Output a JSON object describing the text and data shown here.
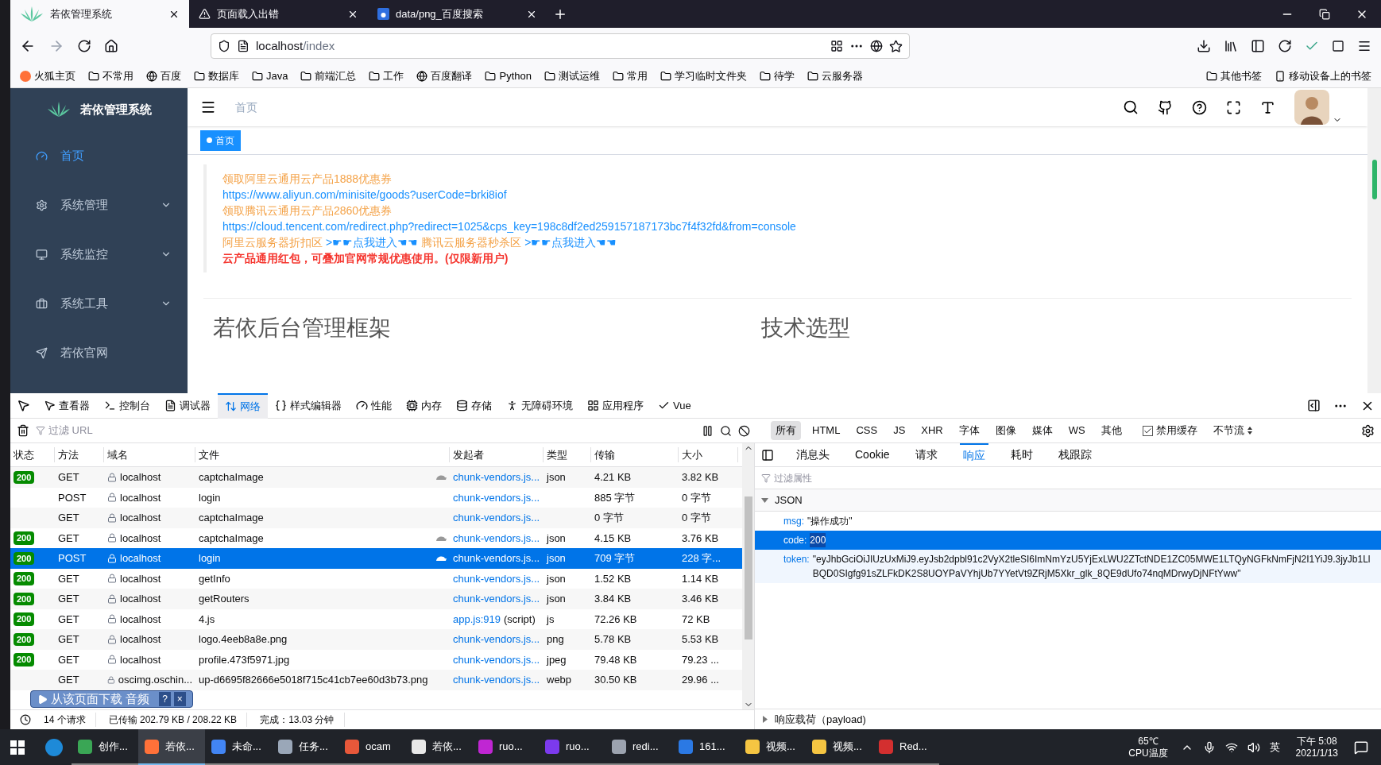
{
  "browser": {
    "tabs": [
      {
        "title": "若依管理系统",
        "selected": true
      },
      {
        "title": "页面载入出错",
        "selected": false
      },
      {
        "title": "data/png_百度搜索",
        "selected": false
      }
    ],
    "url_host": "localhost",
    "url_path": "/index",
    "bookmarks": [
      {
        "label": "火狐主页",
        "kind": "site"
      },
      {
        "label": "不常用",
        "kind": "folder"
      },
      {
        "label": "百度",
        "kind": "globe"
      },
      {
        "label": "数据库",
        "kind": "folder"
      },
      {
        "label": "Java",
        "kind": "folder"
      },
      {
        "label": "前端汇总",
        "kind": "folder"
      },
      {
        "label": "工作",
        "kind": "folder"
      },
      {
        "label": "百度翻译",
        "kind": "globe"
      },
      {
        "label": "Python",
        "kind": "folder"
      },
      {
        "label": "测试运维",
        "kind": "folder"
      },
      {
        "label": "常用",
        "kind": "folder"
      },
      {
        "label": "学习临时文件夹",
        "kind": "folder"
      },
      {
        "label": "待学",
        "kind": "folder"
      },
      {
        "label": "云服务器",
        "kind": "folder"
      }
    ],
    "bookmarks_right": [
      {
        "label": "其他书签",
        "kind": "folder"
      },
      {
        "label": "移动设备上的书签",
        "kind": "mobile"
      }
    ]
  },
  "app": {
    "logo_title": "若依管理系统",
    "sidebar": [
      {
        "label": "首页",
        "selected": true,
        "expandable": false
      },
      {
        "label": "系统管理",
        "selected": false,
        "expandable": true
      },
      {
        "label": "系统监控",
        "selected": false,
        "expandable": true
      },
      {
        "label": "系统工具",
        "selected": false,
        "expandable": true
      },
      {
        "label": "若依官网",
        "selected": false,
        "expandable": false
      }
    ],
    "breadcrumb": "首页",
    "tags": [
      {
        "label": "首页",
        "selected": true
      }
    ],
    "ads": [
      [
        {
          "text": "领取阿里云通用云产品1888优惠券",
          "kind": "promo"
        }
      ],
      [
        {
          "text": "https://www.aliyun.com/minisite/goods?userCode=brki8iof",
          "kind": "link"
        }
      ],
      [
        {
          "text": "领取腾讯云通用云产品2860优惠券",
          "kind": "promo"
        }
      ],
      [
        {
          "text": "https://cloud.tencent.com/redirect.php?redirect=1025&cps_key=198c8df2ed259157187173bc7f4f32fd&from=console",
          "kind": "link"
        }
      ],
      [
        {
          "text": "阿里云服务器折扣区",
          "kind": "promo"
        },
        {
          "text": ">☛☛点我进入☚☚",
          "kind": "link"
        },
        {
          "text": "腾讯云服务器秒杀区",
          "kind": "promo"
        },
        {
          "text": ">☛☛点我进入☚☚",
          "kind": "link"
        }
      ],
      [
        {
          "text": "云产品通用红包，可叠加官网常规优惠使用。(仅限新用户)",
          "kind": "notice"
        }
      ]
    ],
    "headings": [
      "若依后台管理框架",
      "技术选型"
    ]
  },
  "devtools": {
    "tools": [
      {
        "label": "查看器",
        "selected": false
      },
      {
        "label": "控制台",
        "selected": false
      },
      {
        "label": "调试器",
        "selected": false
      },
      {
        "label": "网络",
        "selected": true
      },
      {
        "label": "样式编辑器",
        "selected": false
      },
      {
        "label": "性能",
        "selected": false
      },
      {
        "label": "内存",
        "selected": false
      },
      {
        "label": "存储",
        "selected": false
      },
      {
        "label": "无障碍环境",
        "selected": false
      },
      {
        "label": "应用程序",
        "selected": false
      },
      {
        "label": "Vue",
        "selected": false
      }
    ],
    "filter_placeholder": "过滤 URL",
    "type_filters": [
      {
        "label": "所有",
        "selected": true
      },
      {
        "label": "HTML",
        "selected": false
      },
      {
        "label": "CSS",
        "selected": false
      },
      {
        "label": "JS",
        "selected": false
      },
      {
        "label": "XHR",
        "selected": false
      },
      {
        "label": "字体",
        "selected": false
      },
      {
        "label": "图像",
        "selected": false
      },
      {
        "label": "媒体",
        "selected": false
      },
      {
        "label": "WS",
        "selected": false
      },
      {
        "label": "其他",
        "selected": false
      }
    ],
    "disable_cache": {
      "label": "禁用缓存",
      "checked": true
    },
    "throttle": "不节流",
    "columns": [
      "状态",
      "方法",
      "域名",
      "文件",
      "发起者",
      "类型",
      "传输",
      "大小"
    ],
    "rows": [
      {
        "status": "200",
        "method": "GET",
        "domain": "localhost",
        "file": "captchaImage",
        "flagged": true,
        "initiator": "chunk-vendors.js...",
        "type": "json",
        "transfer": "4.21 KB",
        "size": "3.82 KB",
        "selected": false
      },
      {
        "method": "POST",
        "domain": "localhost",
        "file": "login",
        "flagged": false,
        "initiator": "chunk-vendors.js...",
        "transfer": "885 字节",
        "size": "0 字节",
        "selected": false
      },
      {
        "method": "GET",
        "domain": "localhost",
        "file": "captchaImage",
        "flagged": false,
        "initiator": "chunk-vendors.js...",
        "transfer": "0 字节",
        "size": "0 字节",
        "selected": false
      },
      {
        "status": "200",
        "method": "GET",
        "domain": "localhost",
        "file": "captchaImage",
        "flagged": true,
        "initiator": "chunk-vendors.js...",
        "type": "json",
        "transfer": "4.15 KB",
        "size": "3.76 KB",
        "selected": false
      },
      {
        "status": "200",
        "method": "POST",
        "domain": "localhost",
        "file": "login",
        "flagged": true,
        "initiator": "chunk-vendors.js...",
        "type": "json",
        "transfer": "709 字节",
        "size": "228 字...",
        "selected": true
      },
      {
        "status": "200",
        "method": "GET",
        "domain": "localhost",
        "file": "getInfo",
        "flagged": false,
        "initiator": "chunk-vendors.js...",
        "type": "json",
        "transfer": "1.52 KB",
        "size": "1.14 KB",
        "selected": false
      },
      {
        "status": "200",
        "method": "GET",
        "domain": "localhost",
        "file": "getRouters",
        "flagged": false,
        "initiator": "chunk-vendors.js...",
        "type": "json",
        "transfer": "3.84 KB",
        "size": "3.46 KB",
        "selected": false
      },
      {
        "status": "200",
        "method": "GET",
        "domain": "localhost",
        "file": "4.js",
        "flagged": false,
        "initiator": "app.js:919",
        "initiator_note": "(script)",
        "type": "js",
        "transfer": "72.26 KB",
        "size": "72 KB",
        "selected": false
      },
      {
        "status": "200",
        "method": "GET",
        "domain": "localhost",
        "file": "logo.4eeb8a8e.png",
        "flagged": false,
        "initiator": "chunk-vendors.js...",
        "type": "png",
        "transfer": "5.78 KB",
        "size": "5.53 KB",
        "selected": false
      },
      {
        "status": "200",
        "method": "GET",
        "domain": "localhost",
        "file": "profile.473f5971.jpg",
        "flagged": false,
        "initiator": "chunk-vendors.js...",
        "type": "jpeg",
        "transfer": "79.48 KB",
        "size": "79.23 ...",
        "selected": false
      },
      {
        "method": "GET",
        "domain": "oscimg.oschin...",
        "file": "up-d6695f82666e5018f715c41cb7ee60d3b73.png",
        "flagged": false,
        "initiator": "chunk-vendors.js...",
        "type": "webp",
        "transfer": "30.50 KB",
        "size": "29.96 ...",
        "selected": false
      }
    ],
    "status_bar": [
      "14 个请求",
      "已传输 202.79 KB / 208.22 KB",
      "完成：13.03 分钟"
    ],
    "detail_tabs": [
      {
        "label": "消息头",
        "selected": false
      },
      {
        "label": "Cookie",
        "selected": false
      },
      {
        "label": "请求",
        "selected": false
      },
      {
        "label": "响应",
        "selected": true
      },
      {
        "label": "耗时",
        "selected": false
      },
      {
        "label": "栈跟踪",
        "selected": false
      }
    ],
    "props_placeholder": "过滤属性",
    "json": {
      "label": "JSON",
      "expanded": true,
      "entries": [
        {
          "key": "msg:",
          "value": "\"操作成功\"",
          "selected": false
        },
        {
          "key": "code:",
          "value": "200",
          "selected": true
        },
        {
          "key": "token:",
          "value": "\"eyJhbGciOiJIUzUxMiJ9.eyJsb2dpbl91c2VyX2tleSI6ImNmYzU5YjExLWU2ZTctNDE1ZC05MWE1LTQyNGFkNmFjN2I1YiJ9.3jyJb1LlBQD0SIgfg91sZLFkDK2S8UOYPaVYhjUb7YYetVt9ZRjM5Xkr_glk_8QE9dUfo74nqMDrwyDjNFtYww\"",
          "selected": false
        }
      ]
    },
    "payload": {
      "label": "响应载荷（payload)",
      "expanded": false
    }
  },
  "overlay": {
    "label": "从该页面下载 音频",
    "help": "?",
    "close": "×"
  },
  "taskbar": {
    "apps": [
      {
        "label": "创作...",
        "color": "#3aa655",
        "selected": false
      },
      {
        "label": "若依...",
        "color": "#ff7139",
        "selected": true
      },
      {
        "label": "未命...",
        "color": "#4285f4",
        "selected": false
      },
      {
        "label": "任务...",
        "color": "#9aa7b8",
        "selected": false
      },
      {
        "label": "ocam",
        "color": "#e8583a",
        "selected": false
      },
      {
        "label": "若依...",
        "color": "#e8e8e8",
        "selected": false
      },
      {
        "label": "ruo...",
        "color": "#c026d3",
        "selected": false
      },
      {
        "label": "ruo...",
        "color": "#7c3aed",
        "selected": false
      },
      {
        "label": "redi...",
        "color": "#9ca3af",
        "selected": false
      },
      {
        "label": "161...",
        "color": "#2b79e4",
        "selected": false
      },
      {
        "label": "视频...",
        "color": "#f5c542",
        "selected": false
      },
      {
        "label": "视频...",
        "color": "#f5c542",
        "selected": false
      },
      {
        "label": "Red...",
        "color": "#d32f2f",
        "selected": false
      }
    ],
    "temperature": "65℃",
    "temperature_label": "CPU温度",
    "ime": "英",
    "time": "下午 5:08",
    "date": "2021/1/13"
  }
}
